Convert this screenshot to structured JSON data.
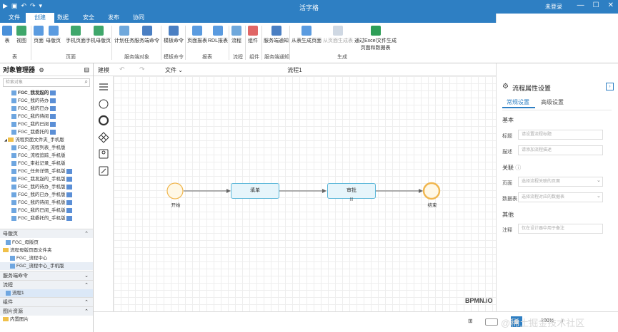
{
  "window": {
    "title": "活字格",
    "user": "未登录",
    "min": "—",
    "max": "☐",
    "close": "✕"
  },
  "menu": {
    "tabs": [
      "文件",
      "创建",
      "数据",
      "安全",
      "发布",
      "协同"
    ],
    "active": 1
  },
  "ribbon": {
    "buttons": [
      {
        "label": "表",
        "icon": "table-icon"
      },
      {
        "label": "视图",
        "icon": "view-icon"
      },
      {
        "label": "页面",
        "icon": "page-icon"
      },
      {
        "label": "母版页",
        "icon": "master-page-icon"
      },
      {
        "label": "手机页面",
        "icon": "mobile-page-icon"
      },
      {
        "label": "手机母版页",
        "icon": "mobile-master-icon"
      },
      {
        "label": "计划任务",
        "icon": "schedule-icon"
      },
      {
        "label": "服务端命令",
        "icon": "server-command-icon"
      },
      {
        "label": "模板命令",
        "icon": "template-command-icon"
      },
      {
        "label": "页面报表",
        "icon": "page-report-icon"
      },
      {
        "label": "RDL报表",
        "icon": "rdl-report-icon"
      },
      {
        "label": "流程",
        "icon": "process-icon"
      },
      {
        "label": "组件",
        "icon": "component-icon"
      },
      {
        "label": "服务端通知",
        "icon": "notify-icon"
      },
      {
        "label": "从表生成页面",
        "icon": "gen-page-icon"
      },
      {
        "label": "从页面生成表",
        "icon": "gen-table-icon"
      },
      {
        "label": "通过Excel文件生成",
        "icon": "excel-icon"
      }
    ],
    "excel_line2": "页面和数据表",
    "groups": [
      "表",
      "页面",
      "服务端对象",
      "模板命令",
      "报表",
      "流程",
      "组件",
      "服务端通知",
      "生成"
    ]
  },
  "left_panel": {
    "title": "对象管理器",
    "search_placeholder": "检索对象",
    "tree_items": [
      {
        "label": "FGC_我发起的",
        "type": "page",
        "mark": true,
        "bold": true
      },
      {
        "label": "FGC_我的待办",
        "type": "page",
        "mark": true
      },
      {
        "label": "FGC_我的已办",
        "type": "page",
        "mark": true
      },
      {
        "label": "FGC_我的待阅",
        "type": "page",
        "mark": true
      },
      {
        "label": "FGC_我的已阅",
        "type": "page",
        "mark": true
      },
      {
        "label": "FGC_我委托的",
        "type": "page",
        "mark": true
      },
      {
        "label": "流程页面文件夹_手机版",
        "type": "folder",
        "mark": false
      },
      {
        "label": "FGC_流程列表_手机版",
        "type": "page",
        "mark": false
      },
      {
        "label": "FGC_流程追踪_手机版",
        "type": "page",
        "mark": false
      },
      {
        "label": "FGC_审批记录_手机版",
        "type": "page",
        "mark": false
      },
      {
        "label": "FGC_任务详情_手机版",
        "type": "page",
        "mark": true
      },
      {
        "label": "FGC_我发起的_手机版",
        "type": "page",
        "mark": true
      },
      {
        "label": "FGC_我的待办_手机版",
        "type": "page",
        "mark": true
      },
      {
        "label": "FGC_我的已办_手机版",
        "type": "page",
        "mark": true
      },
      {
        "label": "FGC_我的待阅_手机版",
        "type": "page",
        "mark": true
      },
      {
        "label": "FGC_我的已阅_手机版",
        "type": "page",
        "mark": true
      },
      {
        "label": "FGC_我委托的_手机版",
        "type": "page",
        "mark": true
      }
    ],
    "section_master": "母版页",
    "master_items": [
      {
        "label": "FGC_母版页",
        "type": "page",
        "indent": 8
      },
      {
        "label": "流程母版页面文件夹",
        "type": "folder",
        "indent": 4
      },
      {
        "label": "FGC_流程中心",
        "type": "page",
        "indent": 14
      },
      {
        "label": "FGC_流程中心_手机版",
        "type": "page",
        "indent": 14
      }
    ],
    "section_server": "服务端命令",
    "section_process": "流程",
    "process_item": "流程1",
    "section_component": "组件",
    "section_images": "图片资源",
    "image_item": "内置图片"
  },
  "canvas": {
    "tabs_label": "建模",
    "file_label": "文件",
    "title": "流程1",
    "nodes": {
      "start": "开始",
      "fill": "填单",
      "approve": "审批",
      "end": "结束"
    },
    "watermark": "BPMN.iO"
  },
  "props": {
    "header": "流程属性设置",
    "tab_general": "常规设置",
    "tab_advanced": "高级设置",
    "sec_basic": "基本",
    "label_title": "标题",
    "ph_title": "请设置流程标题",
    "label_desc": "描述",
    "ph_desc": "请添加流程描述",
    "sec_assoc": "关联",
    "label_page": "页面",
    "ph_page": "选择流程关联的页面",
    "label_table": "数据表",
    "ph_table": "选择流程对应的数据表",
    "sec_other": "其他",
    "label_note": "注释",
    "ph_note": "仅在设计器中用于备注"
  },
  "bottom": {
    "zoom_text": "100%",
    "footer_watermark": "@稀土掘金技术社区"
  },
  "colors": {
    "accent": "#2e7fc3",
    "task_border": "#5bb7d9",
    "event_border": "#f0b64e"
  }
}
